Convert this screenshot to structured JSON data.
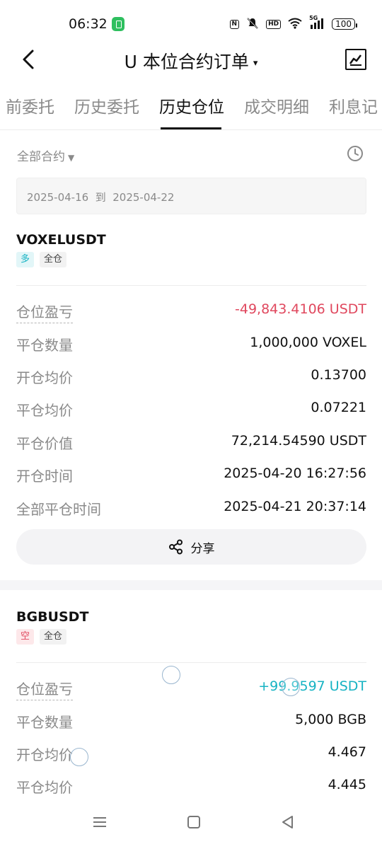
{
  "status_bar": {
    "time": "06:32",
    "nfc": "N",
    "hd": "HD",
    "network": "5G",
    "battery": "100"
  },
  "nav": {
    "title": "U 本位合约订单",
    "caret": "▾"
  },
  "tabs": [
    {
      "label": "前委托",
      "active": false
    },
    {
      "label": "历史委托",
      "active": false
    },
    {
      "label": "历史仓位",
      "active": true
    },
    {
      "label": "成交明细",
      "active": false
    },
    {
      "label": "利息记",
      "active": false
    }
  ],
  "filter": {
    "contract_label": "全部合约",
    "date_range": "2025-04-16  到  2025-04-22"
  },
  "positions": [
    {
      "symbol": "VOXELUSDT",
      "side_tag": "多",
      "margin_tag": "全仓",
      "rows": [
        {
          "label": "仓位盈亏",
          "value": "-49,843.4106 USDT"
        },
        {
          "label": "平仓数量",
          "value": "1,000,000 VOXEL"
        },
        {
          "label": "开仓均价",
          "value": "0.13700"
        },
        {
          "label": "平仓均价",
          "value": "0.07221"
        },
        {
          "label": "平仓价值",
          "value": "72,214.54590 USDT"
        },
        {
          "label": "开仓时间",
          "value": "2025-04-20 16:27:56"
        },
        {
          "label": "全部平仓时间",
          "value": "2025-04-21 20:37:14"
        }
      ],
      "share_label": "分享"
    },
    {
      "symbol": "BGBUSDT",
      "side_tag": "空",
      "margin_tag": "全仓",
      "rows": [
        {
          "label": "仓位盈亏",
          "value": "+99.9597 USDT"
        },
        {
          "label": "平仓数量",
          "value": "5,000 BGB"
        },
        {
          "label": "开仓均价",
          "value": "4.467"
        },
        {
          "label": "平仓均价",
          "value": "4.445"
        }
      ]
    }
  ],
  "colors": {
    "loss": "#e0485e",
    "profit": "#17b3c3"
  }
}
